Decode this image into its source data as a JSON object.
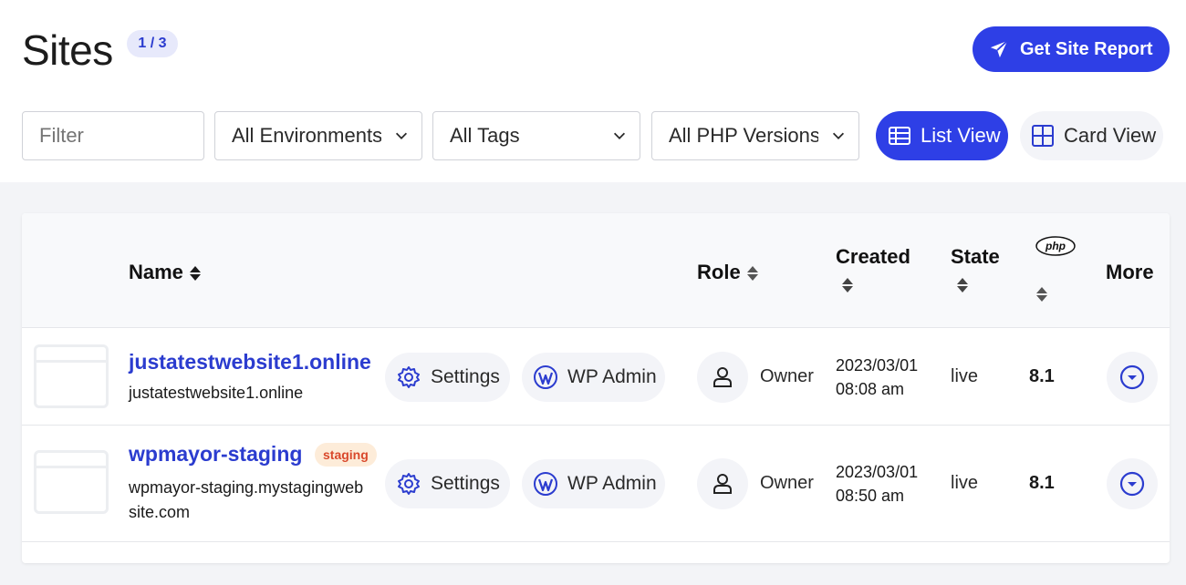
{
  "header": {
    "title": "Sites",
    "count_badge": "1 / 3",
    "report_button": "Get Site Report"
  },
  "filters": {
    "filter_placeholder": "Filter",
    "environments": "All Environments",
    "tags": "All Tags",
    "php_versions": "All PHP Versions"
  },
  "views": {
    "list": "List View",
    "card": "Card View",
    "active": "list"
  },
  "table": {
    "headers": {
      "name": "Name",
      "role": "Role",
      "created": "Created",
      "state": "State",
      "php_logo": "php",
      "more": "More"
    },
    "rows": [
      {
        "name": "justatestwebsite1.online",
        "domain": "justatestwebsite1.online",
        "badge": "",
        "settings": "Settings",
        "wp_admin": "WP Admin",
        "role": "Owner",
        "created_date": "2023/03/01",
        "created_time": "08:08 am",
        "state": "live",
        "php": "8.1"
      },
      {
        "name": "wpmayor-staging",
        "domain_line1": "wpmayor-staging.mystagingweb",
        "domain_line2": "site.com",
        "badge": "staging",
        "settings": "Settings",
        "wp_admin": "WP Admin",
        "role": "Owner",
        "created_date": "2023/03/01",
        "created_time": "08:50 am",
        "state": "live",
        "php": "8.1"
      }
    ]
  },
  "colors": {
    "accent": "#2e3fe6",
    "link": "#2b3ccf",
    "badge_bg": "#e7e9fb",
    "staging_bg": "#fdecd9",
    "staging_text": "#d9482b"
  }
}
